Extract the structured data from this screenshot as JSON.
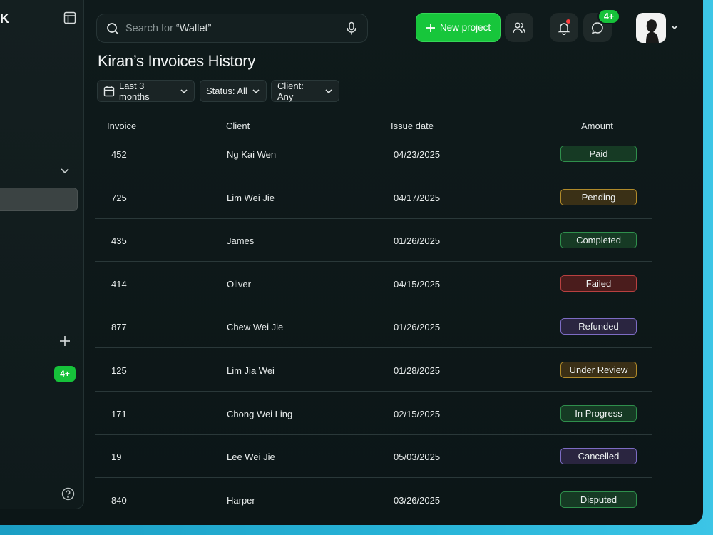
{
  "sidebar": {
    "logo_fragment": "K",
    "badge": "4+"
  },
  "header": {
    "search_prefix": "Search for ",
    "search_query": "“Wallet”",
    "new_project_label": "New project",
    "messages_badge": "4+"
  },
  "page": {
    "title": "Kiran’s Invoices History"
  },
  "filters": {
    "period": "Last 3 months",
    "status": "Status: All",
    "client": "Client: Any"
  },
  "table": {
    "headers": [
      "Invoice",
      "Client",
      "Issue date",
      "Amount"
    ],
    "rows": [
      {
        "invoice": "452",
        "client": "Ng Kai Wen",
        "date": "04/23/2025",
        "status": "Paid"
      },
      {
        "invoice": "725",
        "client": "Lim Wei Jie",
        "date": "04/17/2025",
        "status": "Pending"
      },
      {
        "invoice": "435",
        "client": "James",
        "date": "01/26/2025",
        "status": "Completed"
      },
      {
        "invoice": "414",
        "client": "Oliver",
        "date": "04/15/2025",
        "status": "Failed"
      },
      {
        "invoice": "877",
        "client": "Chew Wei Jie",
        "date": "01/26/2025",
        "status": "Refunded"
      },
      {
        "invoice": "125",
        "client": "Lim Jia Wei",
        "date": "01/28/2025",
        "status": "Under Review"
      },
      {
        "invoice": "171",
        "client": "Chong Wei Ling",
        "date": "02/15/2025",
        "status": "In Progress"
      },
      {
        "invoice": "19",
        "client": "Lee Wei Jie",
        "date": "05/03/2025",
        "status": "Cancelled"
      },
      {
        "invoice": "840",
        "client": "Harper",
        "date": "03/26/2025",
        "status": "Disputed"
      }
    ]
  },
  "status_colors": {
    "Paid": {
      "bg": "#163a24",
      "border": "#2f8f4c"
    },
    "Pending": {
      "bg": "#3a3016",
      "border": "#b08a2a"
    },
    "Completed": {
      "bg": "#163a24",
      "border": "#2f8f4c"
    },
    "Failed": {
      "bg": "#4a1c1c",
      "border": "#b84040"
    },
    "Refunded": {
      "bg": "#2a2540",
      "border": "#7d6cc4"
    },
    "Under Review": {
      "bg": "#3a2f16",
      "border": "#b08a2a"
    },
    "In Progress": {
      "bg": "#163a24",
      "border": "#2f8f4c"
    },
    "Cancelled": {
      "bg": "#2a2540",
      "border": "#7d6cc4"
    },
    "Disputed": {
      "bg": "#163a24",
      "border": "#2f8f4c"
    }
  },
  "colors": {
    "accent": "#17c63b",
    "notification_dot": "#ff3b3b",
    "backdrop": "#28b4d8"
  }
}
